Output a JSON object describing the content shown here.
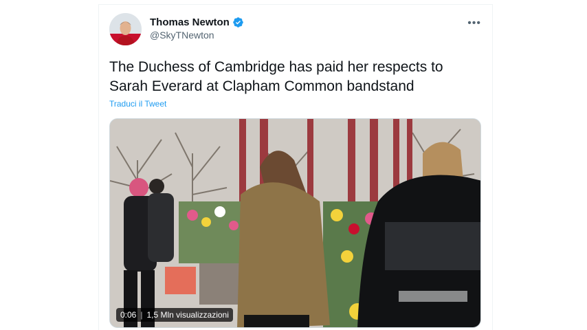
{
  "tweet": {
    "author_name": "Thomas Newton",
    "author_handle": "@SkyTNewton",
    "verified": true,
    "more_label": "•••",
    "text": "The Duchess of Cambridge has paid her respects to Sarah Everard at Clapham Common bandstand",
    "translate_label": "Traduci il Tweet",
    "video": {
      "duration": "0:06",
      "separator": "|",
      "views": "1,5 Mln visualizzazioni"
    }
  },
  "colors": {
    "accent": "#1d9bf0",
    "text": "#0f1419",
    "secondary": "#536471"
  },
  "icons": {
    "verified": "verified-badge-icon",
    "more": "more-options-icon",
    "avatar": "avatar"
  }
}
